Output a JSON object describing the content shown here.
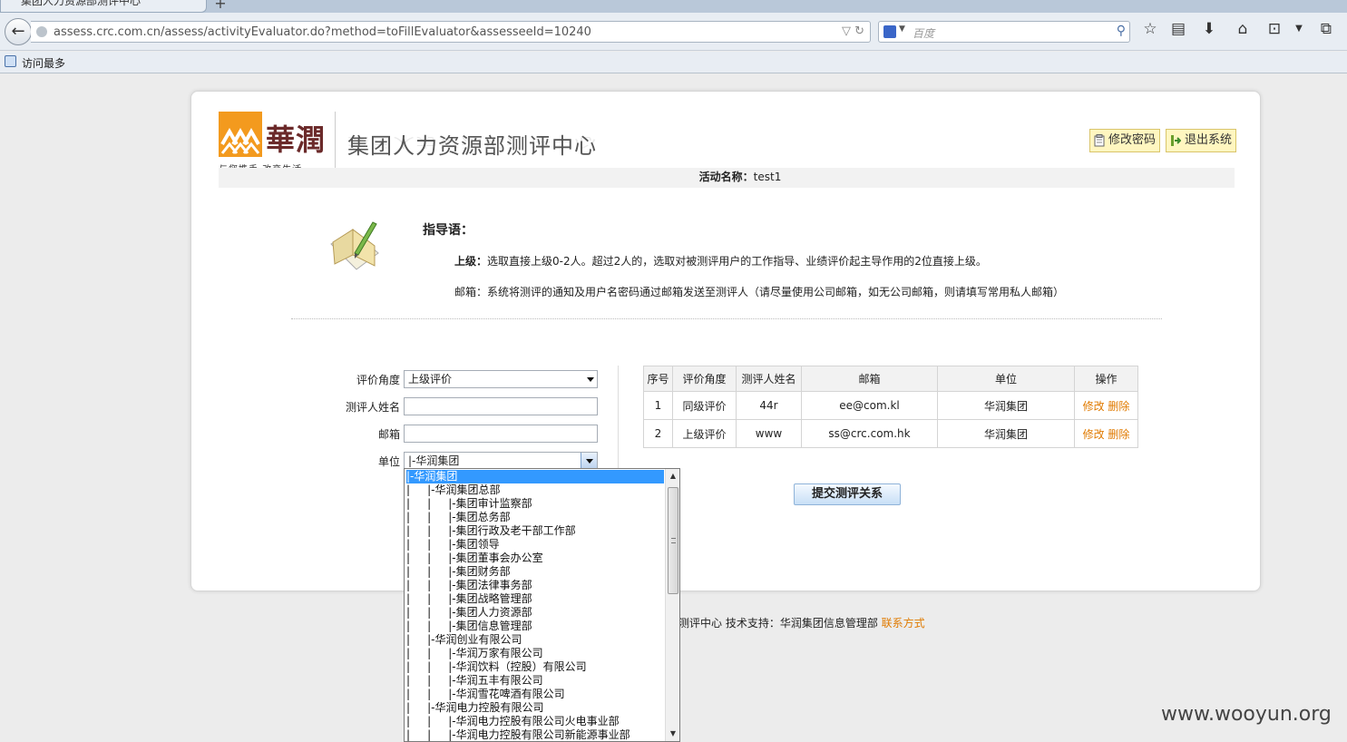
{
  "browser": {
    "tab_title": "集团人力资源部测评中心",
    "url": "assess.crc.com.cn/assess/activityEvaluator.do?method=toFillEvaluator&assesseeId=10240",
    "search_placeholder": "百度",
    "bookmark_label": "访问最多"
  },
  "header": {
    "logo_text": "華潤",
    "slogan": "与您携手 改变生活",
    "site_title": "集团人力资源部测评中心",
    "change_password": "修改密码",
    "logout": "退出系统",
    "activity_label": "活动名称：",
    "activity_name": "test1"
  },
  "guide": {
    "title": "指导语：",
    "superior_label": "上级：",
    "superior_text": "选取直接上级0-2人。超过2人的，选取对被测评用户的工作指导、业绩评价起主导作用的2位直接上级。",
    "email_text": "邮箱：系统将测评的通知及用户名密码通过邮箱发送至测评人（请尽量使用公司邮箱，如无公司邮箱，则请填写常用私人邮箱）"
  },
  "form": {
    "angle_label": "评价角度",
    "angle_value": "上级评价",
    "name_label": "测评人姓名",
    "email_label": "邮箱",
    "unit_label": "单位",
    "unit_value": "|-华润集团"
  },
  "table": {
    "headers": [
      "序号",
      "评价角度",
      "测评人姓名",
      "邮箱",
      "单位",
      "操作"
    ],
    "rows": [
      {
        "no": "1",
        "angle": "同级评价",
        "name": "44r",
        "email": "ee@com.kl",
        "unit": "华润集团",
        "edit": "修改",
        "delete": "删除"
      },
      {
        "no": "2",
        "angle": "上级评价",
        "name": "www",
        "email": "ss@crc.com.hk",
        "unit": "华润集团",
        "edit": "修改",
        "delete": "删除"
      }
    ]
  },
  "submit_label": "提交测评关系",
  "footer": {
    "text": "测评中心   技术支持：华润集团信息管理部",
    "contact": "联系方式"
  },
  "watermark": "www.wooyun.org",
  "dropdown": {
    "items": [
      "|-华润集团",
      "|     |-华润集团总部",
      "|     |     |-集团审计监察部",
      "|     |     |-集团总务部",
      "|     |     |-集团行政及老干部工作部",
      "|     |     |-集团领导",
      "|     |     |-集团董事会办公室",
      "|     |     |-集团财务部",
      "|     |     |-集团法律事务部",
      "|     |     |-集团战略管理部",
      "|     |     |-集团人力资源部",
      "|     |     |-集团信息管理部",
      "|     |-华润创业有限公司",
      "|     |     |-华润万家有限公司",
      "|     |     |-华润饮料（控股）有限公司",
      "|     |     |-华润五丰有限公司",
      "|     |     |-华润雪花啤酒有限公司",
      "|     |-华润电力控股有限公司",
      "|     |     |-华润电力控股有限公司火电事业部",
      "|     |     |-华润电力控股有限公司新能源事业部"
    ]
  }
}
